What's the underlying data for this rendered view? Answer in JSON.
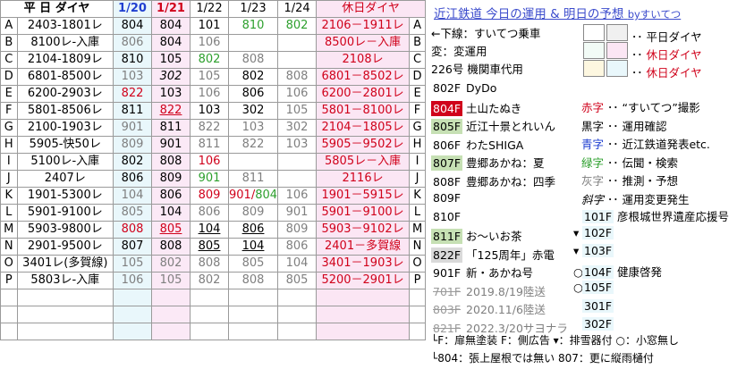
{
  "header": {
    "weekday_label": "平 日 ダイヤ",
    "dates": [
      "1/20",
      "1/21",
      "1/22",
      "1/23",
      "1/24"
    ],
    "holiday_label": "休日ダイヤ"
  },
  "title": {
    "main": "近江鉄道 今日の運用 & 明日の予想",
    "by": "byすいてつ"
  },
  "rows": [
    {
      "label": "A",
      "weekday": "2403-1801レ",
      "cells": [
        "804",
        "804",
        "101",
        "810",
        "802"
      ],
      "holiday": "2106－1911レ"
    },
    {
      "label": "B",
      "weekday": "8100レ-入庫",
      "cells": [
        "806",
        "804",
        "106",
        "",
        ""
      ],
      "holiday": "8500レ－入庫"
    },
    {
      "label": "C",
      "weekday": "2104-1809レ",
      "cells": [
        "810",
        "105",
        "802",
        "808",
        ""
      ],
      "holiday": "2108レ"
    },
    {
      "label": "D",
      "weekday": "6801-8500レ",
      "cells": [
        "103",
        "302",
        "105",
        "802",
        "808"
      ],
      "holiday": "6801－8502レ"
    },
    {
      "label": "E",
      "weekday": "6200-2903レ",
      "cells": [
        "822",
        "103",
        "106",
        "806",
        "106"
      ],
      "holiday": "6200－2801レ"
    },
    {
      "label": "F",
      "weekday": "5801-8506レ",
      "cells": [
        "811",
        "822",
        "103",
        "302",
        "105"
      ],
      "holiday": "5801－8100レ"
    },
    {
      "label": "G",
      "weekday": "2100-1903レ",
      "cells": [
        "901",
        "811",
        "822",
        "103",
        "302"
      ],
      "holiday": "2104－1805レ"
    },
    {
      "label": "H",
      "weekday": "5905-快50レ",
      "cells": [
        "809",
        "901",
        "811",
        "822",
        "103"
      ],
      "holiday": "5905－9502レ"
    },
    {
      "label": "I",
      "weekday": "5100レ-入庫",
      "cells": [
        "802",
        "808",
        "106",
        "",
        ""
      ],
      "holiday": "5805レ－入庫"
    },
    {
      "label": "J",
      "weekday": "2407レ",
      "cells": [
        "806",
        "809",
        "901",
        "811",
        ""
      ],
      "holiday": "2116レ"
    },
    {
      "label": "K",
      "weekday": "1901-5300レ",
      "cells": [
        "104",
        "806",
        "809",
        "901/804",
        "106"
      ],
      "holiday": "1901－5915レ"
    },
    {
      "label": "L",
      "weekday": "5901-9100レ",
      "cells": [
        "805",
        "104",
        "806",
        "809",
        "901"
      ],
      "holiday": "5901－9100レ"
    },
    {
      "label": "M",
      "weekday": "5903-9800レ",
      "cells": [
        "808",
        "805",
        "104",
        "806",
        "809"
      ],
      "holiday": "5903－9102レ"
    },
    {
      "label": "N",
      "weekday": "2901-9500レ",
      "cells": [
        "807",
        "808",
        "805",
        "104",
        "806"
      ],
      "holiday": "2401－多賀線"
    },
    {
      "label": "O",
      "weekday": "3401レ(多賀線)",
      "cells": [
        "105",
        "802",
        "808",
        "805",
        "104"
      ],
      "holiday": "3401－1903レ"
    },
    {
      "label": "P",
      "weekday": "5803レ-入庫",
      "cells": [
        "106",
        "105",
        "802",
        "808",
        "805"
      ],
      "holiday": "5200－2901レ"
    }
  ],
  "right_panel": {
    "notes": [
      "←下線：すいてつ乗車",
      "変：変運用",
      "226号 機関車代用"
    ],
    "legend": [
      {
        "box": "白",
        "text": "平日ダイヤ"
      },
      {
        "box": "",
        "text": "休日ダイヤ"
      },
      {
        "box": "",
        "text": "休日ダイヤ"
      }
    ],
    "cars": [
      {
        "no": "802F",
        "name": "DyDo"
      },
      {
        "no": "804F",
        "name": "土山たぬき"
      },
      {
        "no": "805F",
        "name": "近江十景とれいん"
      },
      {
        "no": "806F",
        "name": "わたSHIGA"
      },
      {
        "no": "807F",
        "name": "豊郷あかね：夏"
      },
      {
        "no": "808F",
        "name": "豊郷あかね：四季"
      },
      {
        "no": "809F",
        "name": ""
      },
      {
        "no": "810F",
        "name": ""
      },
      {
        "no": "811F",
        "name": "お～いお茶"
      },
      {
        "no": "822F",
        "name": "「125周年」赤電"
      },
      {
        "no": "901F",
        "name": "新・あかね号"
      },
      {
        "no": "701F",
        "name": "2019.8/19陸送"
      },
      {
        "no": "803F",
        "name": "2020.11/6陸送"
      },
      {
        "no": "821F",
        "name": "2022.3/20サヨナラ"
      }
    ],
    "color_key": [
      {
        "mark": "赤字",
        "desc": "“すいてつ”撮影"
      },
      {
        "mark": "黒字",
        "desc": "運用確認"
      },
      {
        "mark": "青字",
        "desc": "近江鉄道発表etc."
      },
      {
        "mark": "緑字",
        "desc": "伝聞・検索"
      },
      {
        "mark": "灰字",
        "desc": "推測・予想"
      },
      {
        "mark": "斜字",
        "desc": "運用変更発生"
      }
    ],
    "loco": [
      {
        "no": "101F",
        "desc": "彦根城世界遺産応援号"
      },
      {
        "no": "102F",
        "desc": ""
      },
      {
        "no": "103F",
        "desc": ""
      },
      {
        "no": "104F",
        "desc": "健康啓発"
      },
      {
        "no": "105F",
        "desc": ""
      },
      {
        "no": "301F",
        "desc": ""
      },
      {
        "no": "302F",
        "desc": ""
      }
    ],
    "footer1": "└F：扉無塗装  F：側広告  ▾：排雪器付  ○：小窓無し",
    "footer2": "└804：張上屋根では無い 807：更に縦雨樋付"
  },
  "colors": {
    "red": "#d0021b",
    "grey": "#7f7f7f",
    "green": "#2ea02e",
    "blue": "#1f3fd0",
    "title": "#3b4bcc"
  }
}
